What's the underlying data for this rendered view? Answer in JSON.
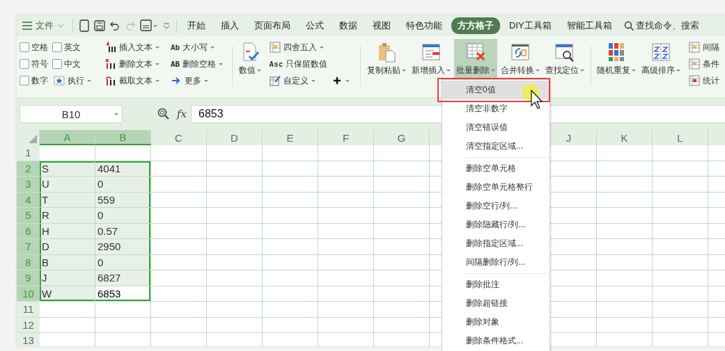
{
  "toolbar": {
    "menu_label": "文件"
  },
  "tabs": [
    {
      "label": "开始",
      "selected": false
    },
    {
      "label": "插入",
      "selected": false
    },
    {
      "label": "页面布局",
      "selected": false
    },
    {
      "label": "公式",
      "selected": false
    },
    {
      "label": "数据",
      "selected": false
    },
    {
      "label": "视图",
      "selected": false
    },
    {
      "label": "特色功能",
      "selected": false
    },
    {
      "label": "方方格子",
      "selected": true
    },
    {
      "label": "DIY工具箱",
      "selected": false
    },
    {
      "label": "智能工具箱",
      "selected": false
    }
  ],
  "search": {
    "placeholder": "查找命令、搜索"
  },
  "ribbon": {
    "groups": [
      {
        "kind": "checks",
        "items": [
          {
            "kind": "checkbox",
            "label": "空格",
            "checked": false
          },
          {
            "kind": "checkbox",
            "label": "英文",
            "checked": false
          },
          {
            "kind": "checkbox",
            "label": "符号",
            "checked": false
          },
          {
            "kind": "checkbox",
            "label": "中文",
            "checked": false
          },
          {
            "kind": "checkbox",
            "label": "数字",
            "checked": false
          },
          {
            "kind": "execute",
            "label": "执行",
            "dropdown": true
          }
        ]
      },
      {
        "kind": "small",
        "items": [
          {
            "kind": "insert",
            "label": "插入文本",
            "dropdown": true
          },
          {
            "kind": "delete",
            "label": "删除文本",
            "dropdown": true
          },
          {
            "kind": "extract",
            "label": "截取文本",
            "dropdown": true
          }
        ]
      },
      {
        "kind": "small",
        "items": [
          {
            "kind": "case",
            "icon_text": "Ab",
            "label": "大小写",
            "dropdown": true
          },
          {
            "kind": "trim",
            "icon_text": "AB",
            "label": "删除空格",
            "dropdown": true
          },
          {
            "kind": "more",
            "label": "更多",
            "dropdown": true
          }
        ]
      },
      {
        "kind": "divider"
      },
      {
        "kind": "big",
        "items": [
          {
            "kind": "value",
            "label": "数值",
            "dropdown": true,
            "selected": false
          }
        ]
      },
      {
        "kind": "small",
        "items": [
          {
            "kind": "round",
            "label": "四舍五入",
            "dropdown": true
          },
          {
            "kind": "numeric",
            "icon_text": "Asc",
            "label": "只保留数值",
            "dropdown": false
          },
          {
            "kind": "custom",
            "label": "自定义",
            "dropdown": true
          }
        ]
      },
      {
        "kind": "tail",
        "items": [
          {
            "kind": "plus",
            "dropdown": true
          }
        ]
      },
      {
        "kind": "divider"
      },
      {
        "kind": "big",
        "items": [
          {
            "kind": "paste",
            "label": "复制粘贴",
            "dropdown": true,
            "selected": false
          },
          {
            "kind": "add",
            "label": "新增插入",
            "dropdown": true,
            "selected": false
          },
          {
            "kind": "remove",
            "label": "批量删除",
            "dropdown": true,
            "selected": true
          },
          {
            "kind": "merge",
            "label": "合并转换",
            "dropdown": true,
            "selected": false
          },
          {
            "kind": "find",
            "label": "查找定位",
            "dropdown": true,
            "selected": false
          }
        ]
      },
      {
        "kind": "divider"
      },
      {
        "kind": "big",
        "items": [
          {
            "kind": "shuffle",
            "label": "随机重复",
            "dropdown": true,
            "selected": false
          },
          {
            "kind": "sort",
            "label": "高级排序",
            "dropdown": true,
            "selected": false
          }
        ]
      },
      {
        "kind": "small",
        "items": [
          {
            "kind": "interval",
            "label": "间隔",
            "dropdown": false
          },
          {
            "kind": "condition",
            "label": "条件",
            "dropdown": false
          },
          {
            "kind": "stats",
            "label": "统计",
            "dropdown": false
          }
        ]
      }
    ]
  },
  "formula_bar": {
    "name_box": "B10",
    "fx_label": "fx",
    "value": "6853"
  },
  "sheet": {
    "columns_left": [
      {
        "label": "A",
        "selected": true
      },
      {
        "label": "B",
        "selected": true
      },
      {
        "label": "C",
        "selected": false
      },
      {
        "label": "D",
        "selected": false
      },
      {
        "label": "E",
        "selected": false
      },
      {
        "label": "F",
        "selected": false
      },
      {
        "label": "G",
        "selected": false
      }
    ],
    "columns_right": [
      {
        "label": "J",
        "selected": false
      },
      {
        "label": "K",
        "selected": false
      },
      {
        "label": "L",
        "selected": false
      }
    ],
    "rows": [
      {
        "number": "1",
        "selected": false
      },
      {
        "number": "2",
        "selected": true,
        "cells": [
          {
            "text": "S",
            "active": false
          },
          {
            "text": "4041",
            "active": false
          }
        ]
      },
      {
        "number": "3",
        "selected": true,
        "cells": [
          {
            "text": "U",
            "active": false
          },
          {
            "text": "0",
            "active": false
          }
        ]
      },
      {
        "number": "4",
        "selected": true,
        "cells": [
          {
            "text": "T",
            "active": false
          },
          {
            "text": "559",
            "active": false
          }
        ]
      },
      {
        "number": "5",
        "selected": true,
        "cells": [
          {
            "text": "R",
            "active": false
          },
          {
            "text": "0",
            "active": false
          }
        ]
      },
      {
        "number": "6",
        "selected": true,
        "cells": [
          {
            "text": "H",
            "active": false
          },
          {
            "text": "0.57",
            "active": false
          }
        ]
      },
      {
        "number": "7",
        "selected": true,
        "cells": [
          {
            "text": "D",
            "active": false
          },
          {
            "text": "2950",
            "active": false
          }
        ]
      },
      {
        "number": "8",
        "selected": true,
        "cells": [
          {
            "text": "B",
            "active": false
          },
          {
            "text": "0",
            "active": false
          }
        ]
      },
      {
        "number": "9",
        "selected": true,
        "cells": [
          {
            "text": "J",
            "active": false
          },
          {
            "text": "6827",
            "active": false
          }
        ]
      },
      {
        "number": "10",
        "selected": true,
        "cells": [
          {
            "text": "W",
            "active": false
          },
          {
            "text": "6853",
            "active": true
          }
        ]
      },
      {
        "number": "11",
        "selected": false
      },
      {
        "number": "12",
        "selected": false
      },
      {
        "number": "13",
        "selected": false
      }
    ]
  },
  "menu": {
    "groups": [
      [
        {
          "label": "清空0值",
          "selected": true
        },
        {
          "label": "清空非数字",
          "selected": false
        },
        {
          "label": "清空错误值",
          "selected": false
        },
        {
          "label": "清空指定区域...",
          "selected": false
        }
      ],
      [
        {
          "label": "删除空单元格",
          "selected": false
        },
        {
          "label": "删除空单元格整行",
          "selected": false
        },
        {
          "label": "删除空行/列...",
          "selected": false
        },
        {
          "label": "删除隐藏行/列...",
          "selected": false
        },
        {
          "label": "删除指定区域...",
          "selected": false
        },
        {
          "label": "间隔删除行/列...",
          "selected": false
        }
      ],
      [
        {
          "label": "删除批注",
          "selected": false
        },
        {
          "label": "删除超链接",
          "selected": false
        },
        {
          "label": "删除对象",
          "selected": false
        },
        {
          "label": "删除条件格式...",
          "selected": false
        }
      ]
    ]
  }
}
